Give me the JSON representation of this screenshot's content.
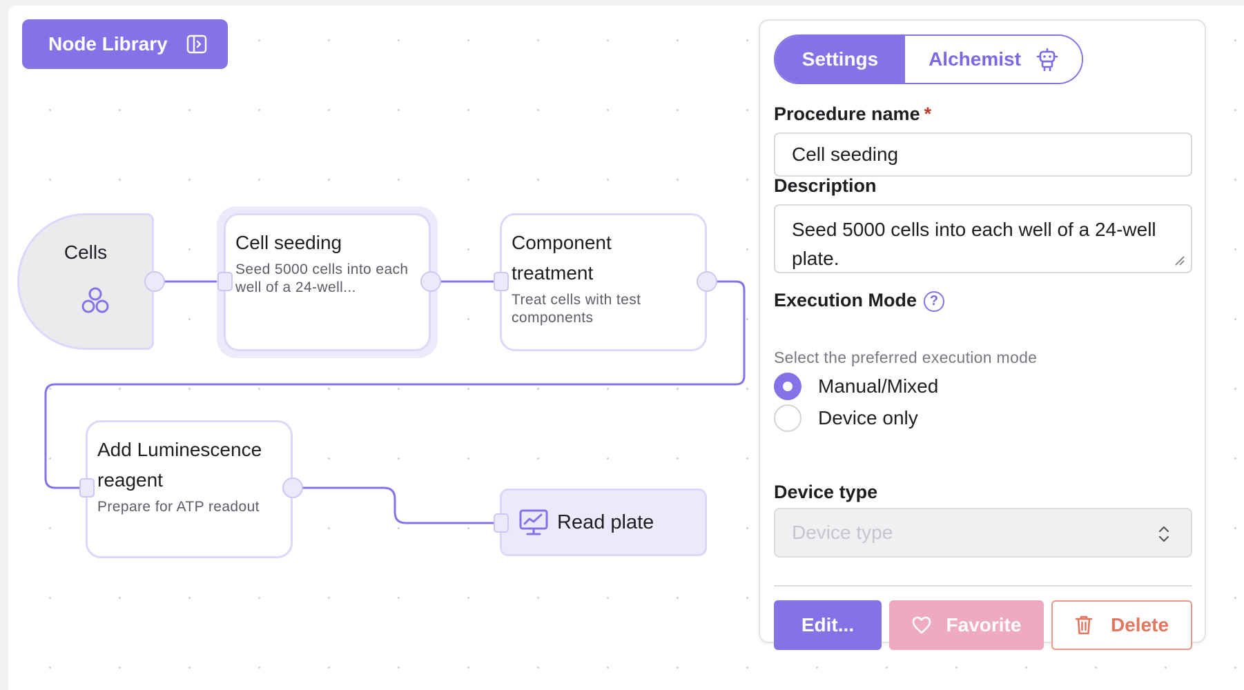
{
  "toolbar": {
    "node_library_label": "Node Library",
    "node_library_icon": "sidebar-toggle-icon"
  },
  "flow": {
    "nodes": [
      {
        "id": "cells",
        "title": "Cells",
        "icon": "cells-icon"
      },
      {
        "id": "cell-seeding",
        "title": "Cell seeding",
        "description": "Seed 5000 cells into each well of a 24-well...",
        "selected": true
      },
      {
        "id": "component-treatment",
        "title": "Component treatment",
        "title_line1": "Component",
        "title_line2": "treatment",
        "description": "Treat cells with test components"
      },
      {
        "id": "add-luminescence",
        "title_line1": "Add Luminescence",
        "title_line2": "reagent",
        "description": "Prepare for ATP readout"
      },
      {
        "id": "read-plate",
        "title": "Read plate",
        "icon": "monitor-chart-icon"
      }
    ]
  },
  "panel": {
    "tabs": [
      {
        "label": "Settings",
        "active": true
      },
      {
        "label": "Alchemist",
        "active": false,
        "icon": "robot-icon"
      }
    ],
    "procedure_name": {
      "label": "Procedure name",
      "required_mark": "*",
      "value": "Cell seeding"
    },
    "description": {
      "label": "Description",
      "value": "Seed 5000 cells into each well of a 24-well plate."
    },
    "execution_mode": {
      "label": "Execution Mode",
      "help_icon": "?",
      "hint": "Select the preferred execution mode",
      "options": [
        {
          "label": "Manual/Mixed",
          "selected": true
        },
        {
          "label": "Device only",
          "selected": false
        }
      ]
    },
    "device_type": {
      "label": "Device type",
      "placeholder": "Device type"
    },
    "buttons": {
      "edit": "Edit...",
      "favorite": "Favorite",
      "delete": "Delete"
    }
  },
  "colors": {
    "accent": "#8373e6",
    "favorite": "#eeaac2",
    "delete": "#e0765e",
    "edge": "#8373e6"
  }
}
